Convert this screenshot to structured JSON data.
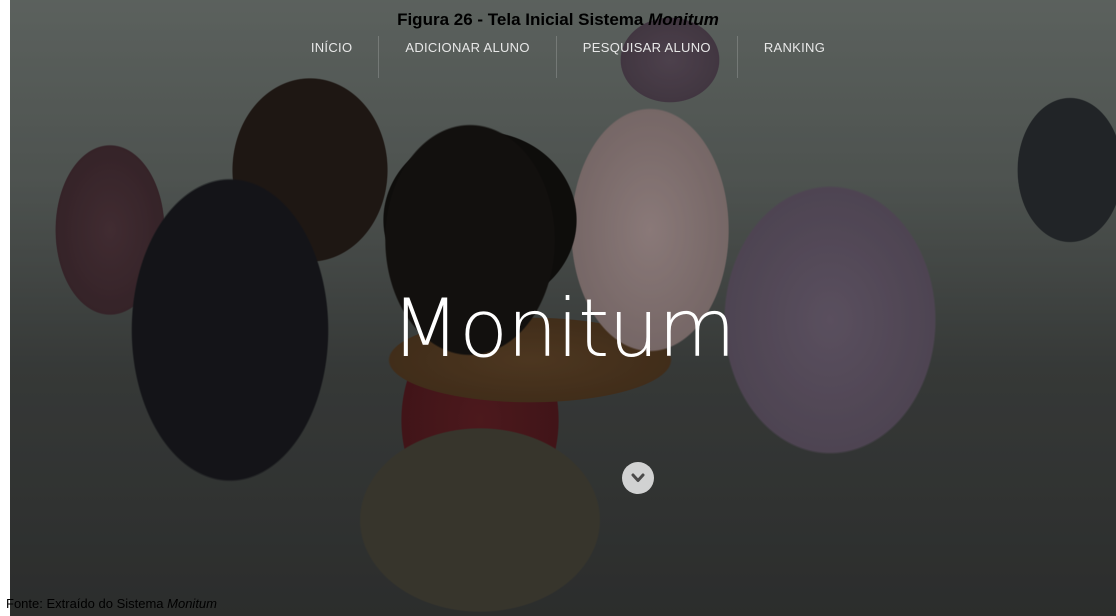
{
  "figure": {
    "title_prefix": "Figura 26 - Tela Inicial Sistema ",
    "title_name": "Monitum",
    "source_prefix": "Fonte: Extraído do Sistema ",
    "source_name": "Monitum"
  },
  "nav": {
    "items": [
      {
        "label": "INÍCIO"
      },
      {
        "label": "ADICIONAR ALUNO"
      },
      {
        "label": "PESQUISAR ALUNO"
      },
      {
        "label": "RANKING"
      }
    ]
  },
  "hero": {
    "title": "Monitum",
    "scroll_icon": "chevron-down-icon"
  },
  "colors": {
    "nav_text": "#e8e8e8",
    "hero_text": "#ffffff",
    "scroll_button_bg": "#ffffffc7",
    "scroll_icon": "#4a4a4a"
  }
}
